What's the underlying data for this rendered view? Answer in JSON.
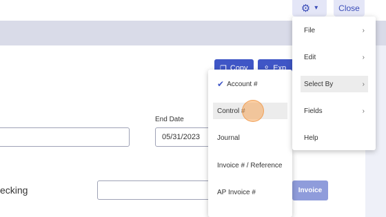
{
  "topbar": {
    "gear_icon": "gear-icon",
    "chevron": "▾",
    "close_label": "Close"
  },
  "toolbar": {
    "copy_label": "Copy",
    "export_label": "Exp"
  },
  "form": {
    "end_date_label": "End Date",
    "end_date_value": "05/31/2023",
    "checking_label": "ecking",
    "invoice_label": "Invoice"
  },
  "select_by_menu": {
    "items": [
      {
        "label": "Account #",
        "checked": true
      },
      {
        "label": "Control #",
        "checked": false
      },
      {
        "label": "Journal",
        "checked": false
      },
      {
        "label": "Invoice # / Reference",
        "checked": false
      },
      {
        "label": "AP Invoice #",
        "checked": false
      }
    ]
  },
  "main_menu": {
    "items": [
      {
        "label": "File",
        "has_submenu": true
      },
      {
        "label": "Edit",
        "has_submenu": true
      },
      {
        "label": "Select By",
        "has_submenu": true
      },
      {
        "label": "Fields",
        "has_submenu": true
      },
      {
        "label": "Help",
        "has_submenu": false
      }
    ]
  },
  "colors": {
    "accent": "#3f56c6",
    "accent_light": "#e4e6f7",
    "band": "#d9dbe8",
    "invoice_disabled": "#8f9cdb"
  }
}
